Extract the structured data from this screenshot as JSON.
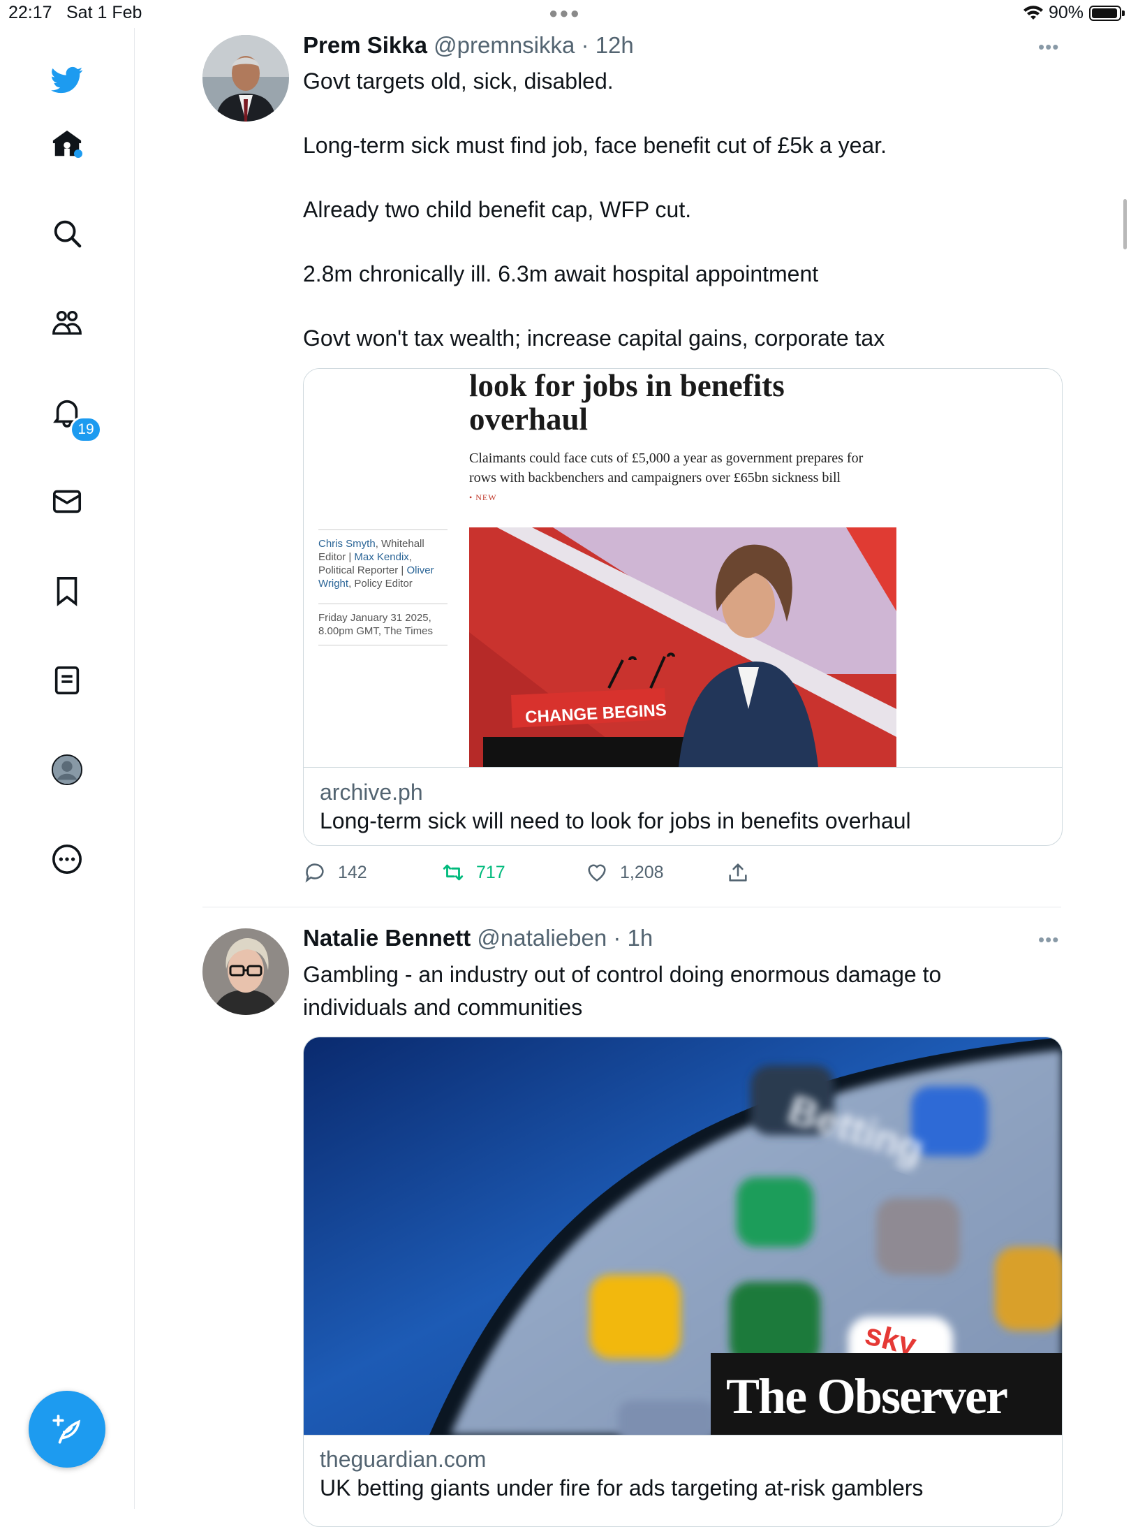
{
  "status": {
    "time": "22:17",
    "date": "Sat 1 Feb",
    "battery": "90%"
  },
  "sidebar": {
    "notifications_badge": "19",
    "items": [
      "home-icon",
      "search-icon",
      "communities-icon",
      "notifications-icon",
      "messages-icon",
      "bookmarks-icon",
      "lists-icon",
      "profile-icon",
      "more-icon"
    ]
  },
  "tweets": [
    {
      "name": "Prem Sikka",
      "handle": "@premnsikka",
      "time": "· 12h",
      "text": "Govt targets old, sick, disabled.\n\nLong-term sick must find job, face benefit cut of £5k a year.\n\nAlready two child benefit cap, WFP cut.\n\n2.8m chronically ill. 6.3m await hospital appointment\n\nGovt won't tax wealth; increase capital gains, corporate tax",
      "card": {
        "headline": "look for jobs in benefits overhaul",
        "standfirst": "Claimants could face cuts of £5,000 a year as government prepares for rows with backbenchers and campaigners over £65bn sickness bill",
        "tag": "• NEW",
        "byline_1": "Chris Smyth",
        "byline_2": ", Whitehall Editor | ",
        "byline_3": "Max Kendix",
        "byline_4": ", Political Reporter | ",
        "byline_5": "Oliver Wright",
        "byline_6": ", Policy Editor",
        "dateline": "Friday January 31 2025, 8.00pm GMT, The Times",
        "lectern": "CHANGE BEGINS",
        "domain": "archive.ph",
        "title": "Long-term sick will need to look for jobs in benefits overhaul"
      },
      "replies": "142",
      "retweets": "717",
      "likes": "1,208"
    },
    {
      "name": "Natalie Bennett",
      "handle": "@natalieben",
      "time": "· 1h",
      "text": "Gambling - an industry out of control doing enormous damage to individuals and communities",
      "card": {
        "image_text": "Betting",
        "sky": "sky",
        "masthead": "The Observer",
        "domain": "theguardian.com",
        "title": "UK betting giants under fire for ads targeting at-risk gamblers"
      }
    }
  ],
  "colors": {
    "accent": "#1d9bf0",
    "retweet": "#00ba7c",
    "secondary": "#536471"
  }
}
